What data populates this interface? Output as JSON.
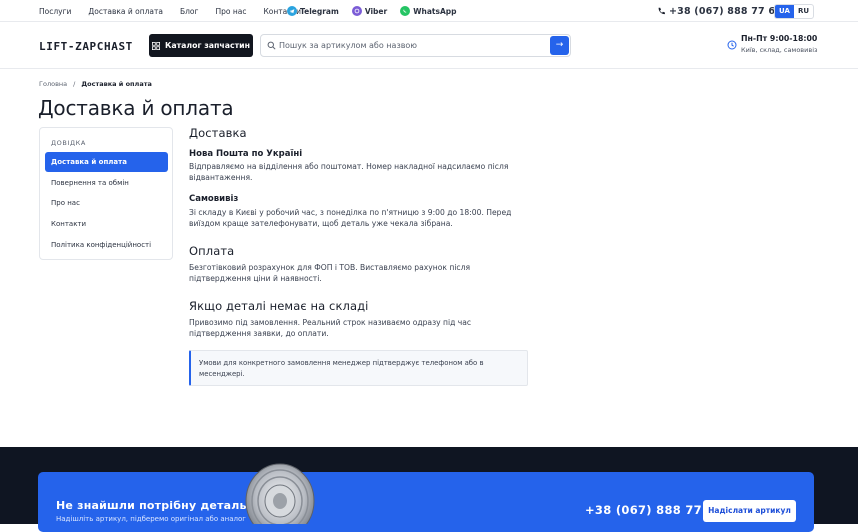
{
  "topbar": {
    "nav": [
      "Послуги",
      "Доставка й оплата",
      "Блог",
      "Про нас",
      "Контакти"
    ],
    "messengers": [
      {
        "label": "Telegram",
        "icon": "telegram-icon",
        "color": "#2aa3df"
      },
      {
        "label": "Viber",
        "icon": "viber-icon",
        "color": "#7b5cd6"
      },
      {
        "label": "WhatsApp",
        "icon": "whatsapp-icon",
        "color": "#25c464"
      }
    ],
    "phone": "+38 (067) 888 77 68",
    "languages": [
      "UA",
      "RU"
    ],
    "active_language": "UA"
  },
  "header": {
    "logo": "LIFT-ZAPCHAST",
    "catalog_button": "Каталог запчастин",
    "search_placeholder": "Пошук за артикулом або назвою",
    "hours": "Пн-Пт 9:00-18:00",
    "hours_sub": "Київ, склад, самовивіз"
  },
  "breadcrumb": {
    "home": "Головна",
    "separator": "/",
    "current": "Доставка й оплата"
  },
  "page_title": "Доставка й оплата",
  "sidebar": {
    "caption": "ДОВІДКА",
    "items": [
      {
        "label": "Доставка й оплата",
        "active": true
      },
      {
        "label": "Повернення та обмін",
        "active": false
      },
      {
        "label": "Про нас",
        "active": false
      },
      {
        "label": "Контакти",
        "active": false
      },
      {
        "label": "Політика конфіденційності",
        "active": false
      }
    ]
  },
  "content": {
    "delivery_title": "Доставка",
    "np_title": "Нова Пошта по Україні",
    "np_text": "Відправляємо на відділення або поштомат. Номер накладної надсилаємо після відвантаження.",
    "pickup_title": "Самовивіз",
    "pickup_text": "Зі складу в Києві у робочий час, з понеділка по п'ятницю з 9:00 до 18:00. Перед виїздом краще зателефонувати, щоб деталь уже чекала зібрана.",
    "payment_title": "Оплата",
    "payment_text": "Безготівковий розрахунок для ФОП і ТОВ. Виставляємо рахунок після підтвердження ціни й наявності.",
    "missing_title": "Якщо деталі немає на складі",
    "missing_text": "Привозимо під замовлення. Реальний строк називаємо одразу під час підтвердження заявки, до оплати.",
    "note": "Умови для конкретного замовлення менеджер підтверджує телефоном або в месенджері."
  },
  "cta": {
    "title": "Не знайшли потрібну деталь?",
    "subtitle": "Надішліть артикул, підберемо оригінал або аналог",
    "phone": "+38 (067) 888 77 68",
    "button": "Надіслати артикул"
  },
  "colors": {
    "accent": "#2563eb",
    "dark": "#12161f",
    "footer": "#0f1522"
  }
}
